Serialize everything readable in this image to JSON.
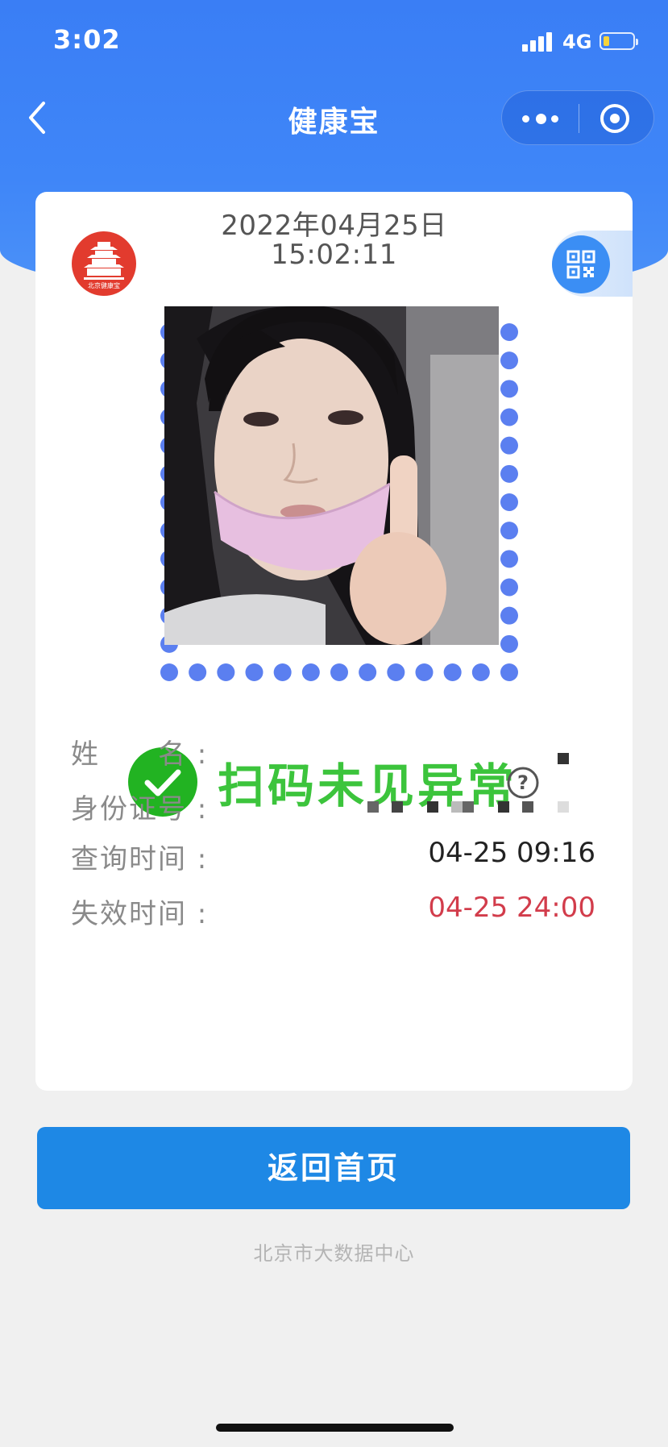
{
  "status_bar": {
    "time": "3:02",
    "network": "4G"
  },
  "nav": {
    "title": "健康宝",
    "back_icon": "chevron-left-icon",
    "menu_icon": "more-dots-icon",
    "close_icon": "target-close-icon"
  },
  "card": {
    "date": "2022年04月25日",
    "time": "15:02:11",
    "logo_text": "北京健康宝",
    "status_text": "扫码未见异常",
    "status_color": "#3cc43c",
    "frame_color": "#5b7ff0",
    "rows": [
      {
        "label": "姓　　名 :",
        "value": ""
      },
      {
        "label": "身份证号 :",
        "value": ""
      },
      {
        "label": "查询时间 :",
        "value": "04-25 09:16"
      },
      {
        "label": "失效时间 :",
        "value": "04-25 24:00"
      }
    ]
  },
  "home_button": "返回首页",
  "footer": "北京市大数据中心",
  "colors": {
    "header_blue": "#3a7ef5",
    "button_blue": "#1e88e5",
    "expiry_red": "#d23c4b"
  }
}
